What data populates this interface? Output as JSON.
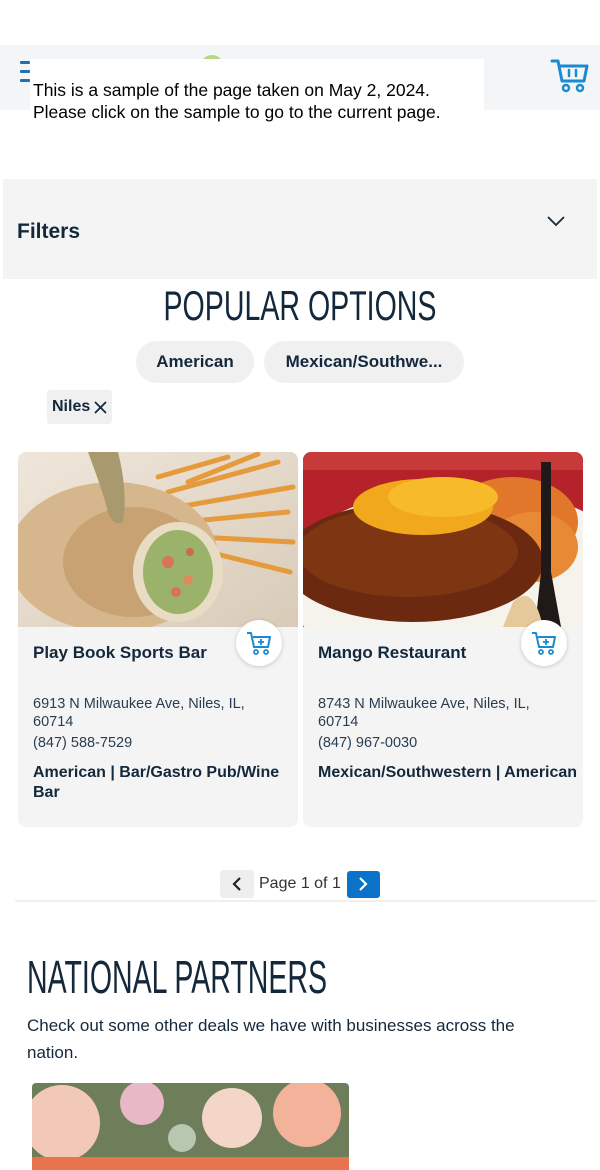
{
  "notice": {
    "line1": "This is a sample of the page taken on May 2, 2024.",
    "line2": "Please click on the sample to go to the current page."
  },
  "header": {
    "menu_icon": "hamburger-icon",
    "cart_icon": "shopping-cart-icon"
  },
  "filters": {
    "label": "Filters",
    "toggle_icon": "chevron-down-icon"
  },
  "popular": {
    "title": "POPULAR OPTIONS",
    "pills": [
      "American",
      "Mexican/Southwe..."
    ]
  },
  "active_tag": {
    "label": "Niles",
    "remove_icon": "close-icon"
  },
  "listings": [
    {
      "name": "Play Book Sports Bar",
      "address": "6913 N Milwaukee Ave, Niles, IL, 60714",
      "phone": "(847) 588-7529",
      "categories": "American | Bar/Gastro Pub/Wine Bar",
      "image": "wrap-sandwich-with-fries-photo"
    },
    {
      "name": "Mango Restaurant",
      "address": "8743 N Milwaukee Ave, Niles, IL, 60714",
      "phone": "(847) 967-0030",
      "categories": "Mexican/Southwestern | American",
      "image": "enchilada-with-rice-photo"
    }
  ],
  "pagination": {
    "text": "Page 1 of 1",
    "prev_icon": "chevron-left-icon",
    "next_icon": "chevron-right-icon"
  },
  "national": {
    "title": "NATIONAL PARTNERS",
    "description": "Check out some other deals we have with businesses across the nation.",
    "partner_image": "flowers-photo"
  },
  "colors": {
    "accent_blue": "#0a72c9",
    "text_navy": "#14283c",
    "card_bg": "#f4f4f4"
  }
}
